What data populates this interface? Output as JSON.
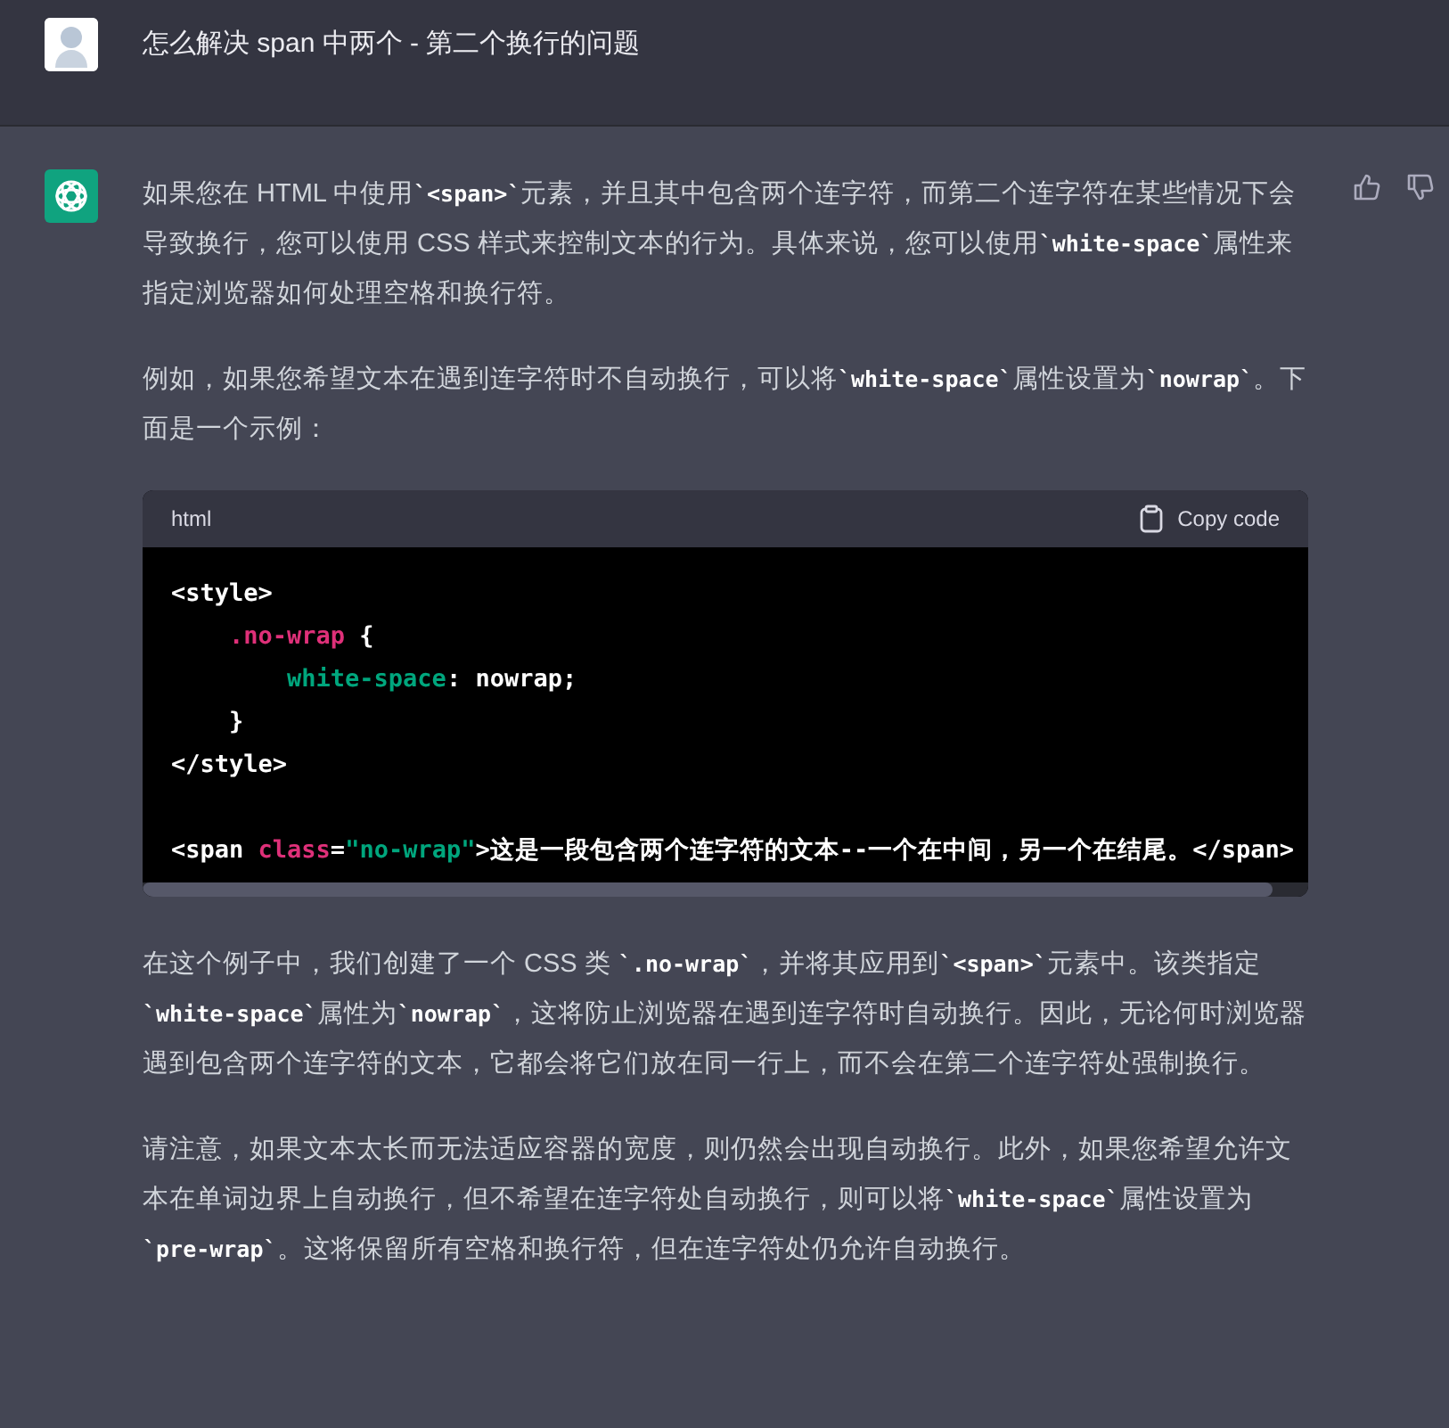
{
  "question": {
    "text": "怎么解决 span 中两个 - 第二个换行的问题"
  },
  "answer": {
    "paragraphs_before": [
      [
        {
          "kind": "text",
          "text": "如果您在 HTML 中使用"
        },
        {
          "kind": "code",
          "text": "`<span>`"
        },
        {
          "kind": "text",
          "text": "元素，并且其中包含两个连字符，而第二个连字符在某些情况下会导致换行，您可以使用 CSS 样式来控制文本的行为。具体来说，您可以使用"
        },
        {
          "kind": "code",
          "text": "`white-space`"
        },
        {
          "kind": "text",
          "text": "属性来指定浏览器如何处理空格和换行符。"
        }
      ],
      [
        {
          "kind": "text",
          "text": "例如，如果您希望文本在遇到连字符时不自动换行，可以将"
        },
        {
          "kind": "code",
          "text": "`white-space`"
        },
        {
          "kind": "text",
          "text": "属性设置为"
        },
        {
          "kind": "code",
          "text": "`nowrap`"
        },
        {
          "kind": "text",
          "text": "。下面是一个示例："
        }
      ]
    ],
    "code_block": {
      "language": "html",
      "copy_label": "Copy code",
      "blocks": [
        [
          [
            {
              "kind": "plain",
              "text": "<style>"
            }
          ],
          [
            {
              "kind": "selector",
              "text": "    .no-wrap"
            },
            {
              "kind": "plain",
              "text": " {"
            }
          ],
          [
            {
              "kind": "property",
              "text": "        white-space"
            },
            {
              "kind": "plain",
              "text": ": nowrap;"
            }
          ],
          [
            {
              "kind": "plain",
              "text": "    }"
            }
          ],
          [
            {
              "kind": "plain",
              "text": "</style>"
            }
          ]
        ],
        [
          [
            {
              "kind": "plain",
              "text": "<span "
            },
            {
              "kind": "attr",
              "text": "class"
            },
            {
              "kind": "plain",
              "text": "="
            },
            {
              "kind": "string",
              "text": "\"no-wrap\""
            },
            {
              "kind": "plain",
              "text": ">这是一段包含两个连字符的文本--一个在中间，另一个在结尾。</span>"
            }
          ]
        ]
      ]
    },
    "paragraphs_after": [
      [
        {
          "kind": "text",
          "text": "在这个例子中，我们创建了一个 CSS 类 "
        },
        {
          "kind": "code",
          "text": "`.no-wrap`"
        },
        {
          "kind": "text",
          "text": "，并将其应用到"
        },
        {
          "kind": "code",
          "text": "`<span>`"
        },
        {
          "kind": "text",
          "text": "元素中。该类指定"
        },
        {
          "kind": "code",
          "text": "`white-space`"
        },
        {
          "kind": "text",
          "text": "属性为"
        },
        {
          "kind": "code",
          "text": "`nowrap`"
        },
        {
          "kind": "text",
          "text": "，这将防止浏览器在遇到连字符时自动换行。因此，无论何时浏览器遇到包含两个连字符的文本，它都会将它们放在同一行上，而不会在第二个连字符处强制换行。"
        }
      ],
      [
        {
          "kind": "text",
          "text": "请注意，如果文本太长而无法适应容器的宽度，则仍然会出现自动换行。此外，如果您希望允许文本在单词边界上自动换行，但不希望在连字符处自动换行，则可以将"
        },
        {
          "kind": "code",
          "text": "`white-space`"
        },
        {
          "kind": "text",
          "text": "属性设置为"
        },
        {
          "kind": "code",
          "text": "`pre-wrap`"
        },
        {
          "kind": "text",
          "text": "。这将保留所有空格和换行符，但在连字符处仍允许自动换行。"
        }
      ]
    ]
  }
}
